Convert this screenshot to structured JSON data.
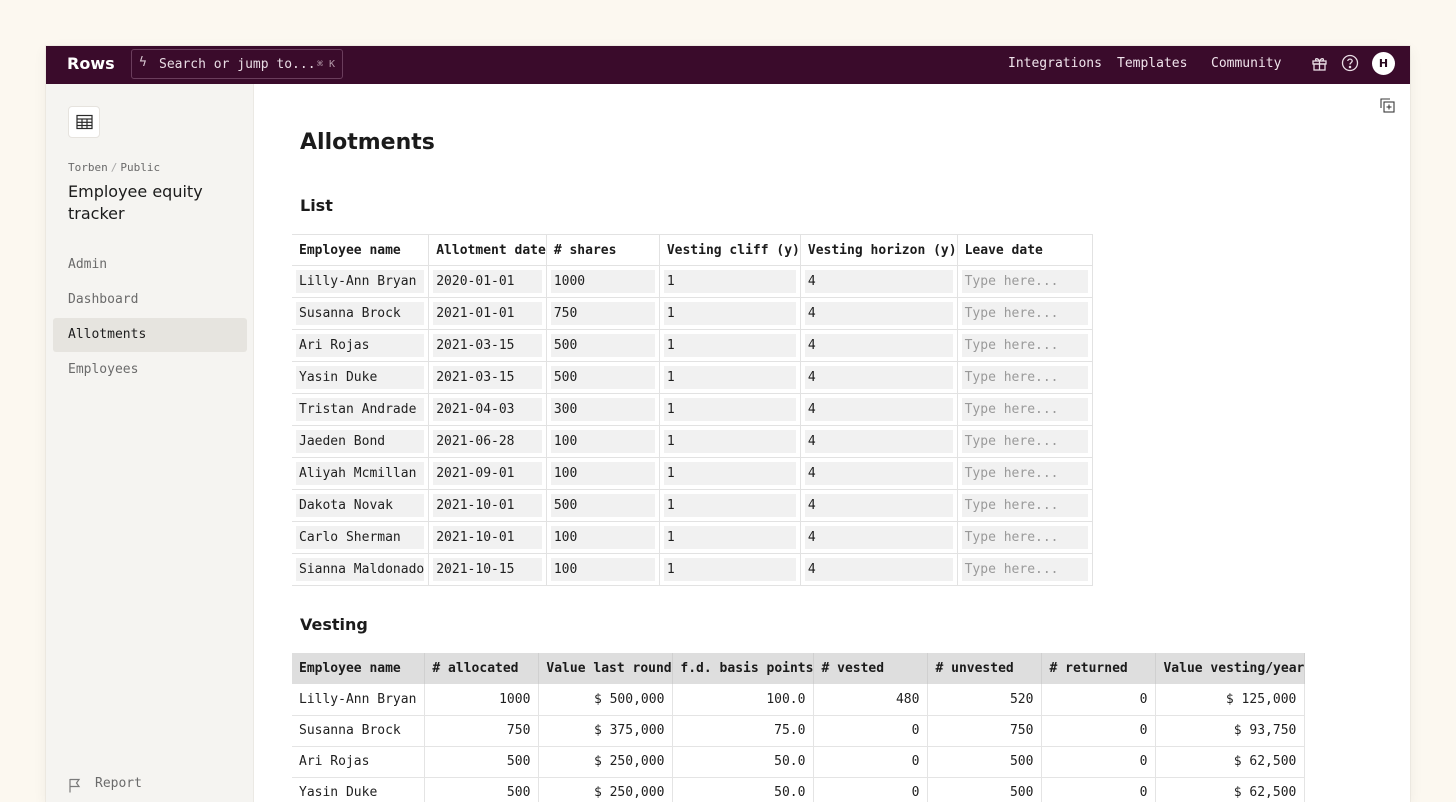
{
  "topbar": {
    "logo": "Rows",
    "search_placeholder": "Search or jump to...",
    "search_shortcut": "⌘ K",
    "nav": [
      "Integrations",
      "Templates",
      "Community"
    ],
    "avatar_initial": "H"
  },
  "sidebar": {
    "breadcrumb": [
      "Torben",
      "Public"
    ],
    "doc_title": "Employee equity tracker",
    "items": [
      {
        "label": "Admin",
        "active": false
      },
      {
        "label": "Dashboard",
        "active": false
      },
      {
        "label": "Allotments",
        "active": true
      },
      {
        "label": "Employees",
        "active": false
      }
    ],
    "report_label": "Report"
  },
  "page": {
    "title": "Allotments"
  },
  "list": {
    "title": "List",
    "columns": [
      "Employee name",
      "Allotment date",
      "# shares",
      "Vesting cliff (y)",
      "Vesting horizon (y)",
      "Leave date"
    ],
    "leave_placeholder": "Type here...",
    "rows": [
      [
        "Lilly-Ann Bryan",
        "2020-01-01",
        "1000",
        "1",
        "4"
      ],
      [
        "Susanna Brock",
        "2021-01-01",
        "750",
        "1",
        "4"
      ],
      [
        "Ari Rojas",
        "2021-03-15",
        "500",
        "1",
        "4"
      ],
      [
        "Yasin Duke",
        "2021-03-15",
        "500",
        "1",
        "4"
      ],
      [
        "Tristan Andrade",
        "2021-04-03",
        "300",
        "1",
        "4"
      ],
      [
        "Jaeden Bond",
        "2021-06-28",
        "100",
        "1",
        "4"
      ],
      [
        "Aliyah Mcmillan",
        "2021-09-01",
        "100",
        "1",
        "4"
      ],
      [
        "Dakota Novak",
        "2021-10-01",
        "500",
        "1",
        "4"
      ],
      [
        "Carlo Sherman",
        "2021-10-01",
        "100",
        "1",
        "4"
      ],
      [
        "Sianna Maldonado",
        "2021-10-15",
        "100",
        "1",
        "4"
      ]
    ]
  },
  "vesting": {
    "title": "Vesting",
    "columns": [
      "Employee name",
      "# allocated",
      "Value last round",
      "f.d. basis points",
      "# vested",
      "# unvested",
      "# returned",
      "Value vesting/year"
    ],
    "rows": [
      [
        "Lilly-Ann Bryan",
        "1000",
        "$ 500,000",
        "100.0",
        "480",
        "520",
        "0",
        "$ 125,000"
      ],
      [
        "Susanna Brock",
        "750",
        "$ 375,000",
        "75.0",
        "0",
        "750",
        "0",
        "$ 93,750"
      ],
      [
        "Ari Rojas",
        "500",
        "$ 250,000",
        "50.0",
        "0",
        "500",
        "0",
        "$ 62,500"
      ],
      [
        "Yasin Duke",
        "500",
        "$ 250,000",
        "50.0",
        "0",
        "500",
        "0",
        "$ 62,500"
      ]
    ]
  },
  "colors": {
    "topbar_bg": "#3a0b2b",
    "sidebar_bg": "#f5f4f1",
    "page_bg": "#fcf8f0",
    "active_item_bg": "#e6e4df"
  }
}
